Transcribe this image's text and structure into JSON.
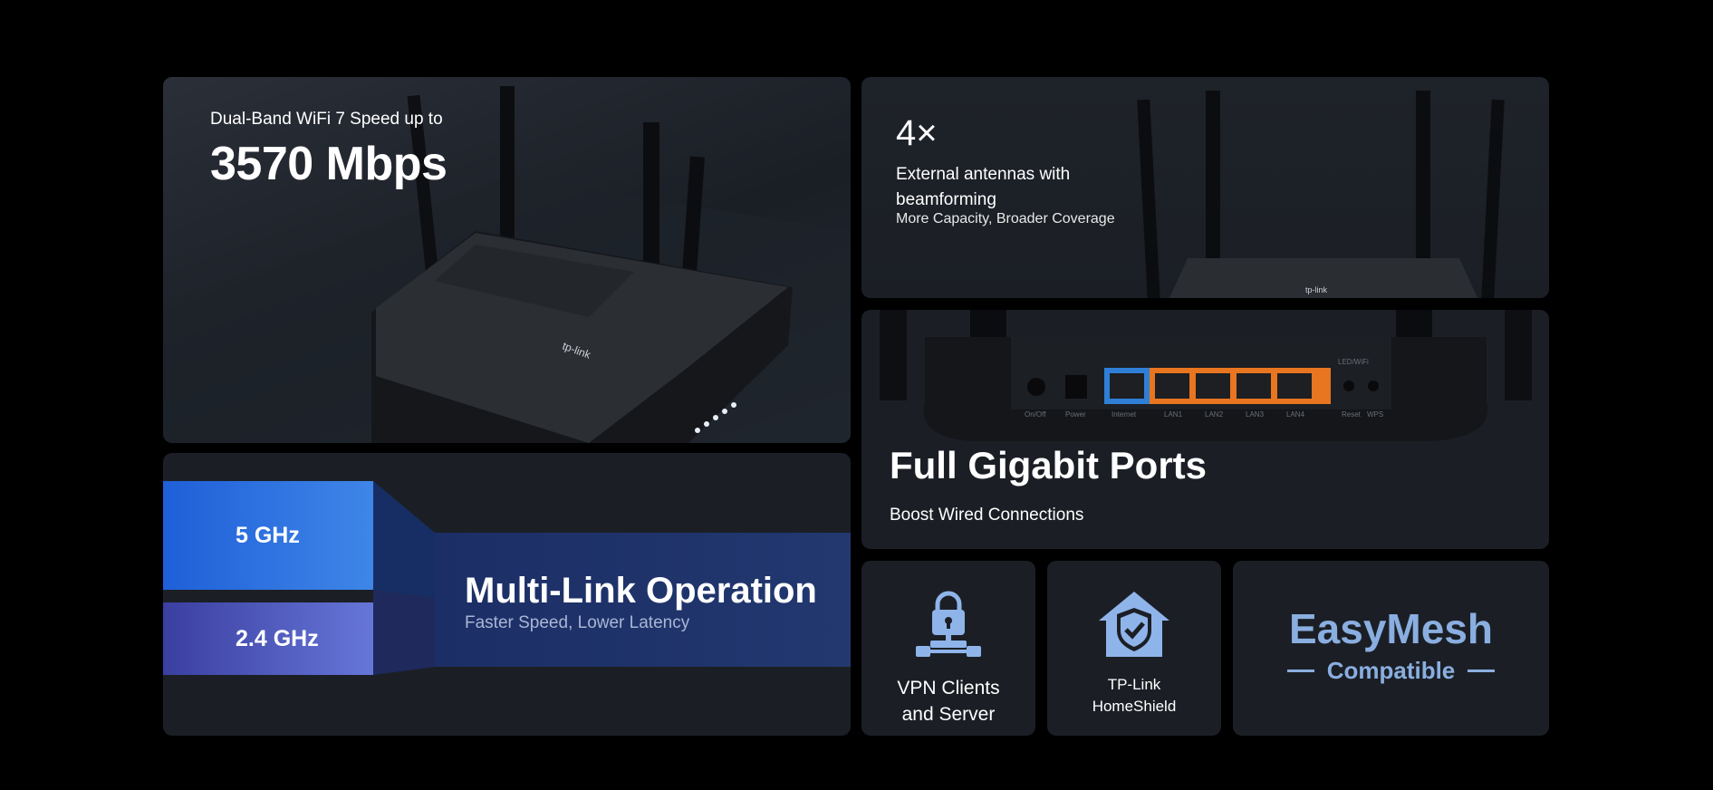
{
  "hero": {
    "subtitle": "Dual-Band WiFi 7 Speed up to",
    "speed": "3570 Mbps",
    "brand_mark": "tp-link"
  },
  "antennas": {
    "count": "4×",
    "title": "External antennas with beamforming",
    "subtitle": "More Capacity, Broader Coverage",
    "brand_mark": "tp-link"
  },
  "ports": {
    "title": "Full Gigabit Ports",
    "subtitle": "Boost Wired Connections",
    "panel_labels": [
      "On/Off",
      "Power",
      "Internet",
      "LAN1",
      "LAN2",
      "LAN3",
      "LAN4",
      "LED/WiFi",
      "Reset",
      "WPS"
    ],
    "colors": {
      "internet": "#2f7fd6",
      "lan": "#e8751f"
    }
  },
  "mlo": {
    "band_5": "5 GHz",
    "band_24": "2.4 GHz",
    "title": "Multi-Link Operation",
    "subtitle": "Faster Speed, Lower Latency"
  },
  "vpn": {
    "label_line1": "VPN Clients",
    "label_line2": "and Server",
    "icon": "lock-network-icon"
  },
  "homeshield": {
    "label_line1": "TP-Link",
    "label_line2": "HomeShield",
    "icon": "shield-house-icon"
  },
  "easymesh": {
    "title": "EasyMesh",
    "subtitle": "Compatible"
  }
}
